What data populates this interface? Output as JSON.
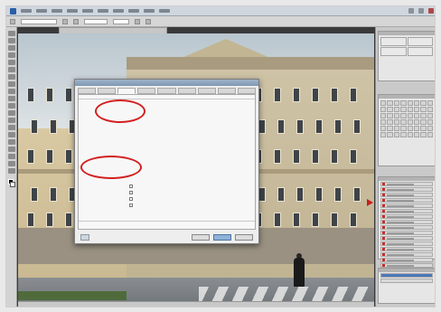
{
  "app": {
    "title": "",
    "document_tab": ""
  },
  "menu": {
    "items": [
      "",
      "",
      "",
      "",
      "",
      "",
      "",
      "",
      "",
      ""
    ]
  },
  "dialog": {
    "title": "",
    "tabs": [
      "",
      "",
      "",
      "",
      "",
      "",
      "",
      "",
      ""
    ],
    "active_tab": 2,
    "sections": {
      "top": "",
      "bottom": ""
    },
    "rows": [
      {
        "label": "",
        "value": ""
      },
      {
        "label": "",
        "value": ""
      },
      {
        "label": "",
        "value": ""
      },
      {
        "label": "",
        "value": ""
      },
      {
        "label": "",
        "value": ""
      },
      {
        "label": "",
        "value": ""
      },
      {
        "label": "",
        "value": ""
      },
      {
        "label": "",
        "value": ""
      },
      {
        "label": "",
        "value": ""
      }
    ],
    "checkboxes": [
      {
        "label": ""
      },
      {
        "label": ""
      },
      {
        "label": ""
      },
      {
        "label": ""
      }
    ],
    "footer": {
      "field_label": "",
      "field_value": "",
      "cancel": "",
      "ok": "",
      "other": ""
    }
  },
  "panels": {
    "info_title": "",
    "swatches_title": "",
    "layers_title": "",
    "history_title": "",
    "layers": [
      "",
      "",
      "",
      "",
      "",
      "",
      "",
      "",
      "",
      "",
      "",
      "",
      "",
      "",
      "",
      ""
    ]
  },
  "status": {
    "text": ""
  },
  "colors": {
    "highlight_ring": "#d32020",
    "accent": "#4c78b8",
    "arrow": "#c81e1e"
  },
  "icons": [
    "ps-logo-icon",
    "move-tool-icon",
    "marquee-tool-icon",
    "lasso-tool-icon",
    "crop-tool-icon",
    "brush-tool-icon",
    "eraser-tool-icon",
    "type-tool-icon",
    "zoom-tool-icon",
    "eye-icon",
    "arrow-pointer-icon"
  ]
}
